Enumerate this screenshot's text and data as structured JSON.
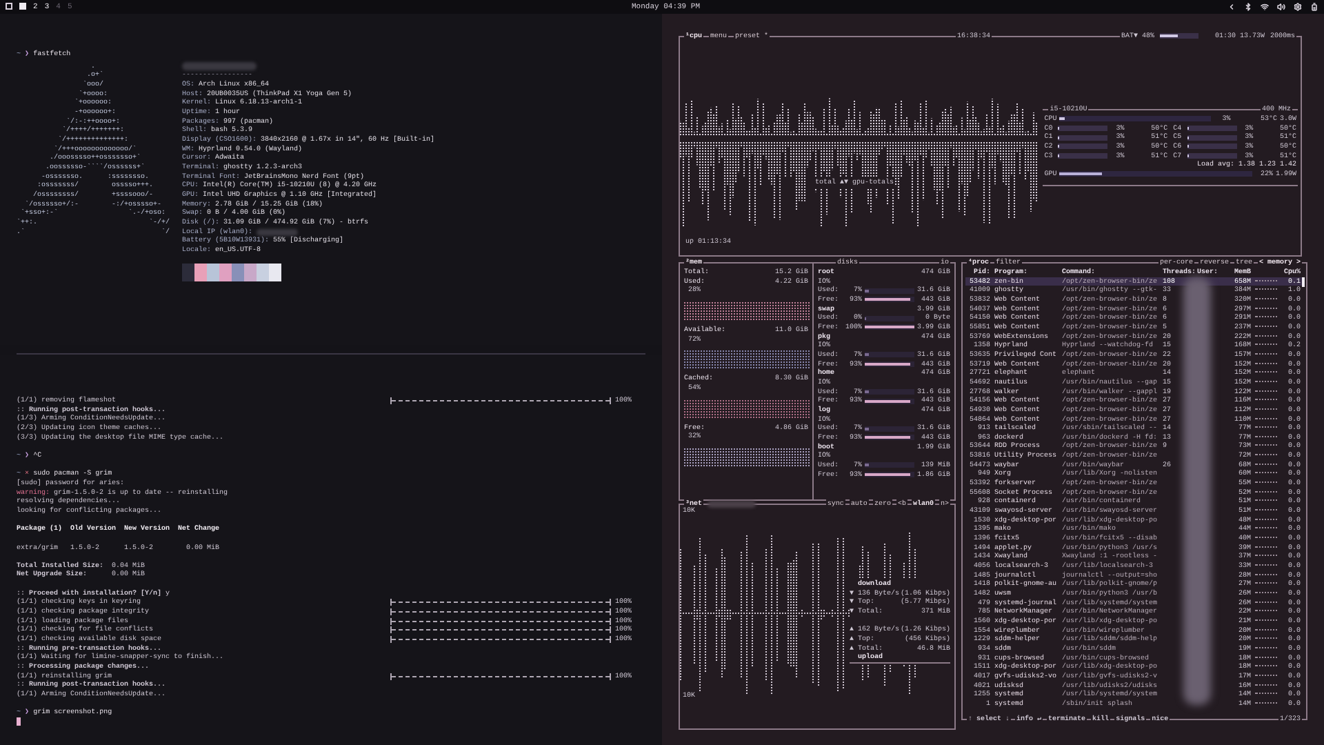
{
  "top_bar": {
    "workspaces": [
      {
        "selected": true,
        "occupied": true
      },
      {
        "label": "2",
        "selected": false,
        "occupied": true
      },
      {
        "label": "3",
        "selected": false,
        "occupied": true
      },
      {
        "label": "4",
        "selected": false,
        "occupied": false
      },
      {
        "label": "5",
        "selected": false,
        "occupied": false
      }
    ],
    "clock": "Monday 04:39 PM"
  },
  "fastfetch": {
    "prompt": {
      "dir": "~",
      "symbol": "❯",
      "command": "fastfetch",
      "error": false
    },
    "logo": [
      "                  .",
      "                 .o+`",
      "                `ooo/",
      "               `+oooo:",
      "              `+oooooo:",
      "              -+oooooo+:",
      "            `/:-:++oooo+:",
      "           `/++++/+++++++:",
      "          `/++++++++++++++:",
      "         `/+++ooooooooooooo/`",
      "        ./ooosssso++osssssso+`",
      "       .oossssso-````/ossssss+`",
      "      -osssssso.      :ssssssso.",
      "     :osssssss/        osssso+++.",
      "    /ossssssss/        +ssssooo/-",
      "  `/ossssso+/:-        -:/+osssso+-",
      " `+sso+:-`                 `.-/+oso:",
      "`++:.                           `-/+/",
      ".`                                 `/"
    ],
    "separator": "-----------------",
    "info": [
      {
        "key": "OS:",
        "value": "Arch Linux x86_64"
      },
      {
        "key": "Host:",
        "value": "20UB0035US (ThinkPad X1 Yoga Gen 5)"
      },
      {
        "key": "Kernel:",
        "value": "Linux 6.18.13-arch1-1"
      },
      {
        "key": "Uptime:",
        "value": "1 hour"
      },
      {
        "key": "Packages:",
        "value": "997 (pacman)"
      },
      {
        "key": "Shell:",
        "value": "bash 5.3.9"
      },
      {
        "key": "Display (CSO1600):",
        "value": "3840x2160 @ 1.67x in 14\", 60 Hz [Built-in]"
      },
      {
        "key": "WM:",
        "value": "Hyprland 0.54.0 (Wayland)"
      },
      {
        "key": "Cursor:",
        "value": "Adwaita"
      },
      {
        "key": "Terminal:",
        "value": "ghostty 1.2.3-arch3"
      },
      {
        "key": "Terminal Font:",
        "value": "JetBrainsMono Nerd Font (9pt)"
      },
      {
        "key": "CPU:",
        "value": "Intel(R) Core(TM) i5-10210U (8) @ 4.20 GHz"
      },
      {
        "key": "GPU:",
        "value": "Intel UHD Graphics @ 1.10 GHz [Integrated]"
      },
      {
        "key": "Memory:",
        "value": "2.78 GiB / 15.25 GiB (18%)"
      },
      {
        "key": "Swap:",
        "value": "0 B / 4.00 GiB (0%)"
      },
      {
        "key": "Disk (/):",
        "value": "31.09 GiB / 474.92 GiB (7%) - btrfs"
      },
      {
        "key": "Local IP (wlan0):"
      },
      {
        "key": "Battery (5B10W13931):",
        "value": "55% [Discharging]"
      },
      {
        "key": "Locale:",
        "value": "en_US.UTF-8"
      }
    ],
    "palette": [
      {
        "color": "#2c2c3a"
      },
      {
        "color": "#e8a0b8"
      },
      {
        "color": "#b8c4d8"
      },
      {
        "color": "#e0a0c0"
      },
      {
        "color": "#8890b8"
      },
      {
        "color": "#c8a8c8"
      },
      {
        "color": "#c8d0e0"
      },
      {
        "color": "#e8e8f0"
      }
    ]
  },
  "terminal": {
    "lines": [
      {
        "kind": "text",
        "text": "(1/1) removing flameshot",
        "progress": {
          "level": 1,
          "reading": "100%"
        }
      },
      {
        "kind": "text",
        "text": ":: **Running post-transaction hooks...**"
      },
      {
        "kind": "text",
        "text": "(1/3) Arming ConditionNeedsUpdate..."
      },
      {
        "kind": "text",
        "text": "(2/3) Updating icon theme caches..."
      },
      {
        "kind": "text",
        "text": "(3/3) Updating the desktop file MIME type cache..."
      },
      {
        "kind": "blank"
      },
      {
        "kind": "prompt",
        "dir": "~",
        "symbol": "❯",
        "command": "^C",
        "error": false
      },
      {
        "kind": "blank"
      },
      {
        "kind": "prompt",
        "dir": "~",
        "symbol": "×",
        "command": "sudo pacman -S grim",
        "error": true
      },
      {
        "kind": "text",
        "text": "[sudo] password for aries:"
      },
      {
        "kind": "warning",
        "label": "warning:",
        "text": "grim-1.5.0-2 is up to date -- reinstalling"
      },
      {
        "kind": "text",
        "text": "resolving dependencies..."
      },
      {
        "kind": "text",
        "text": "looking for conflicting packages..."
      },
      {
        "kind": "blank"
      },
      {
        "kind": "text",
        "text": "Package (1)  Old Version  New Version  Net Change",
        "bold": true
      },
      {
        "kind": "blank"
      },
      {
        "kind": "text",
        "text": "extra/grim   1.5.0-2      1.5.0-2        0.00 MiB"
      },
      {
        "kind": "blank"
      },
      {
        "kind": "text",
        "text": "**Total Installed Size:**  0.04 MiB"
      },
      {
        "kind": "text",
        "text": "**Net Upgrade Size:**      0.00 MiB"
      },
      {
        "kind": "blank"
      },
      {
        "kind": "text",
        "text": ":: **Proceed with installation? [Y/n]** y"
      },
      {
        "kind": "text",
        "text": "(1/1) checking keys in keyring",
        "progress": {
          "level": 1,
          "reading": "100%"
        }
      },
      {
        "kind": "text",
        "text": "(1/1) checking package integrity",
        "progress": {
          "level": 1,
          "reading": "100%"
        }
      },
      {
        "kind": "text",
        "text": "(1/1) loading package files",
        "progress": {
          "level": 1,
          "reading": "100%"
        }
      },
      {
        "kind": "text",
        "text": "(1/1) checking for file conflicts",
        "progress": {
          "level": 1,
          "reading": "100%"
        }
      },
      {
        "kind": "text",
        "text": "(1/1) checking available disk space",
        "progress": {
          "level": 1,
          "reading": "100%"
        }
      },
      {
        "kind": "text",
        "text": ":: **Running pre-transaction hooks...**"
      },
      {
        "kind": "text",
        "text": "(1/1) Waiting for limine-snapper-sync to finish..."
      },
      {
        "kind": "text",
        "text": ":: **Processing package changes...**"
      },
      {
        "kind": "text",
        "text": "(1/1) reinstalling grim",
        "progress": {
          "level": 1,
          "reading": "100%"
        }
      },
      {
        "kind": "text",
        "text": ":: **Running post-transaction hooks...**"
      },
      {
        "kind": "text",
        "text": "(1/1) Arming ConditionNeedsUpdate..."
      },
      {
        "kind": "blank"
      },
      {
        "kind": "prompt",
        "dir": "~",
        "symbol": "❯",
        "command": "grim screenshot.png",
        "error": false
      },
      {
        "kind": "cursor"
      }
    ]
  },
  "btop": {
    "cpu": {
      "titles": [
        "¹cpu",
        "menu",
        "preset *"
      ],
      "clock": "16:38:34",
      "battery": {
        "label": "BAT▼ 48%",
        "level": 0.48
      },
      "power": "01:30 13.73W",
      "interval": "2000ms",
      "graph_label": "total ▲▼ gpu-totals",
      "uptime": "up 01:13:34",
      "model": "i5-10210U",
      "freq": "400 MHz",
      "total": {
        "name": "CPU",
        "level": 0.03,
        "percent": "3%",
        "temp": "53°C",
        "watts": "3.0W"
      },
      "cores": [
        {
          "name": "C0",
          "level": 0.03,
          "percent": "3%",
          "temp": "50°C"
        },
        {
          "name": "C4",
          "level": 0.03,
          "percent": "3%",
          "temp": "50°C"
        },
        {
          "name": "C1",
          "level": 0.03,
          "percent": "3%",
          "temp": "51°C"
        },
        {
          "name": "C5",
          "level": 0.03,
          "percent": "3%",
          "temp": "51°C"
        },
        {
          "name": "C2",
          "level": 0.03,
          "percent": "3%",
          "temp": "50°C"
        },
        {
          "name": "C6",
          "level": 0.03,
          "percent": "3%",
          "temp": "50°C"
        },
        {
          "name": "C3",
          "level": 0.03,
          "percent": "3%",
          "temp": "51°C"
        },
        {
          "name": "C7",
          "level": 0.03,
          "percent": "3%",
          "temp": "51°C"
        }
      ],
      "load": "Load avg: 1.38 1.23 1.42",
      "gpu": {
        "name": "GPU",
        "level": 0.22,
        "percent": "22%",
        "watts": "1.99W"
      }
    },
    "mem": {
      "title": "²mem",
      "rows": [
        {
          "label": "Total:",
          "value": "15.2 GiB"
        },
        {
          "label": "Used:",
          "value": "4.22 GiB",
          "percent": "28%"
        },
        {
          "label": "Available:",
          "value": "11.0 GiB",
          "percent": "72%"
        },
        {
          "label": "Cached:",
          "value": "8.30 GiB",
          "percent": "54%"
        },
        {
          "label": "Free:",
          "value": "4.86 GiB",
          "percent": "32%"
        }
      ]
    },
    "disks": {
      "title": "disks",
      "io_title": "io",
      "items": [
        {
          "name": "root",
          "size": "474 GiB",
          "io": "IO%",
          "used": {
            "label": "Used:",
            "percent": "7%",
            "value": "31.6 GiB",
            "level": 0.07
          },
          "free": {
            "label": "Free:",
            "percent": "93%",
            "value": "443 GiB",
            "level": 0.93
          }
        },
        {
          "name": "swap",
          "size": "3.99 GiB",
          "used": {
            "label": "Used:",
            "percent": "0%",
            "value": "0 Byte",
            "level": 0
          },
          "free": {
            "label": "Free:",
            "percent": "100%",
            "value": "3.99 GiB",
            "level": 1
          }
        },
        {
          "name": "pkg",
          "size": "474 GiB",
          "io": "IO%",
          "used": {
            "label": "Used:",
            "percent": "7%",
            "value": "31.6 GiB",
            "level": 0.07
          },
          "free": {
            "label": "Free:",
            "percent": "93%",
            "value": "443 GiB",
            "level": 0.93
          }
        },
        {
          "name": "home",
          "size": "474 GiB",
          "io": "IO%",
          "used": {
            "label": "Used:",
            "percent": "7%",
            "value": "31.6 GiB",
            "level": 0.07
          },
          "free": {
            "label": "Free:",
            "percent": "93%",
            "value": "443 GiB",
            "level": 0.93
          }
        },
        {
          "name": "log",
          "size": "474 GiB",
          "io": "IO%",
          "used": {
            "label": "Used:",
            "percent": "7%",
            "value": "31.6 GiB",
            "level": 0.07
          },
          "free": {
            "label": "Free:",
            "percent": "93%",
            "value": "443 GiB",
            "level": 0.93
          }
        },
        {
          "name": "boot",
          "size": "1.99 GiB",
          "io": "IO%",
          "used": {
            "label": "Used:",
            "percent": "7%",
            "value": "139 MiB",
            "level": 0.07
          },
          "free": {
            "label": "Free:",
            "percent": "93%",
            "value": "1.86 GiB",
            "level": 0.93
          }
        }
      ]
    },
    "net": {
      "title": "³net",
      "options": [
        "sync",
        "auto",
        "zero"
      ],
      "iface": [
        "<b",
        "wlan0",
        "n>"
      ],
      "scale_top": "10K",
      "scale_bottom": "10K",
      "download": {
        "title": "download",
        "rows": [
          {
            "arrow": "▼",
            "label": "136 Byte/s",
            "value": "(1.06 Kibps)"
          },
          {
            "arrow": "▼",
            "label": "Top:",
            "value": "(5.77 Mibps)"
          },
          {
            "arrow": "▼",
            "label": "Total:",
            "value": "371 MiB"
          }
        ]
      },
      "upload": {
        "title": "upload",
        "rows": [
          {
            "arrow": "▲",
            "label": "162 Byte/s",
            "value": "(1.26 Kibps)"
          },
          {
            "arrow": "▲",
            "label": "Top:",
            "value": "(456 Kibps)"
          },
          {
            "arrow": "▲",
            "label": "Total:",
            "value": "46.8 MiB"
          }
        ]
      }
    },
    "proc": {
      "titles": [
        "⁴proc",
        "filter"
      ],
      "options": [
        "per-core",
        "reverse",
        "tree",
        "< memory >"
      ],
      "columns": [
        "Pid:",
        "Program:",
        "Command:",
        "Threads:",
        "User:",
        "MemB",
        "Cpu%"
      ],
      "rows": [
        {
          "pid": "53482",
          "program": "zen-bin",
          "command": "/opt/zen-browser-bin/ze",
          "threads": "108",
          "mem": "658M",
          "cpu": "0.1",
          "selected": true
        },
        {
          "pid": "41009",
          "program": "ghostty",
          "command": "/usr/bin/ghostty --gtk-",
          "threads": "33",
          "mem": "384M",
          "cpu": "1.0",
          "selected": false
        },
        {
          "pid": "53832",
          "program": "Web Content",
          "command": "/opt/zen-browser-bin/ze",
          "threads": "8",
          "mem": "320M",
          "cpu": "0.0",
          "selected": false
        },
        {
          "pid": "54037",
          "program": "Web Content",
          "command": "/opt/zen-browser-bin/ze",
          "threads": "6",
          "mem": "297M",
          "cpu": "0.0",
          "selected": false
        },
        {
          "pid": "54150",
          "program": "Web Content",
          "command": "/opt/zen-browser-bin/ze",
          "threads": "6",
          "mem": "291M",
          "cpu": "0.0",
          "selected": false
        },
        {
          "pid": "55851",
          "program": "Web Content",
          "command": "/opt/zen-browser-bin/ze",
          "threads": "5",
          "mem": "237M",
          "cpu": "0.0",
          "selected": false
        },
        {
          "pid": "53769",
          "program": "WebExtensions",
          "command": "/opt/zen-browser-bin/ze",
          "threads": "20",
          "mem": "222M",
          "cpu": "0.0",
          "selected": false
        },
        {
          "pid": "1358",
          "program": "Hyprland",
          "command": "Hyprland --watchdog-fd",
          "threads": "15",
          "mem": "168M",
          "cpu": "0.2",
          "selected": false
        },
        {
          "pid": "53635",
          "program": "Privileged Cont",
          "command": "/opt/zen-browser-bin/ze",
          "threads": "22",
          "mem": "157M",
          "cpu": "0.0",
          "selected": false
        },
        {
          "pid": "53719",
          "program": "Web Content",
          "command": "/opt/zen-browser-bin/ze",
          "threads": "20",
          "mem": "152M",
          "cpu": "0.0",
          "selected": false
        },
        {
          "pid": "27721",
          "program": "elephant",
          "command": "elephant",
          "threads": "14",
          "mem": "152M",
          "cpu": "0.0",
          "selected": false
        },
        {
          "pid": "54692",
          "program": "nautilus",
          "command": "/usr/bin/nautilus --gap",
          "threads": "15",
          "mem": "152M",
          "cpu": "0.0",
          "selected": false
        },
        {
          "pid": "27768",
          "program": "walker",
          "command": "/usr/bin/walker --gappl",
          "threads": "19",
          "mem": "122M",
          "cpu": "0.0",
          "selected": false
        },
        {
          "pid": "54156",
          "program": "Web Content",
          "command": "/opt/zen-browser-bin/ze",
          "threads": "27",
          "mem": "116M",
          "cpu": "0.0",
          "selected": false
        },
        {
          "pid": "54930",
          "program": "Web Content",
          "command": "/opt/zen-browser-bin/ze",
          "threads": "27",
          "mem": "112M",
          "cpu": "0.0",
          "selected": false
        },
        {
          "pid": "54864",
          "program": "Web Content",
          "command": "/opt/zen-browser-bin/ze",
          "threads": "27",
          "mem": "110M",
          "cpu": "0.0",
          "selected": false
        },
        {
          "pid": "913",
          "program": "tailscaled",
          "command": "/usr/sbin/tailscaled --",
          "threads": "14",
          "mem": "77M",
          "cpu": "0.0",
          "selected": false
        },
        {
          "pid": "963",
          "program": "dockerd",
          "command": "/usr/bin/dockerd -H fd:",
          "threads": "13",
          "mem": "77M",
          "cpu": "0.0",
          "selected": false
        },
        {
          "pid": "53644",
          "program": "RDD Process",
          "command": "/opt/zen-browser-bin/ze",
          "threads": "9",
          "mem": "73M",
          "cpu": "0.0",
          "selected": false
        },
        {
          "pid": "53816",
          "program": "Utility Process",
          "command": "/opt/zen-browser-bin/ze",
          "mem": "72M",
          "cpu": "0.0",
          "selected": false
        },
        {
          "pid": "54473",
          "program": "waybar",
          "command": "/usr/bin/waybar",
          "threads": "26",
          "mem": "68M",
          "cpu": "0.0",
          "selected": false
        },
        {
          "pid": "949",
          "program": "Xorg",
          "command": "/usr/lib/Xorg -nolisten",
          "mem": "60M",
          "cpu": "0.0",
          "selected": false
        },
        {
          "pid": "53392",
          "program": "forkserver",
          "command": "/opt/zen-browser-bin/ze",
          "mem": "55M",
          "cpu": "0.0",
          "selected": false
        },
        {
          "pid": "55608",
          "program": "Socket Process",
          "command": "/opt/zen-browser-bin/ze",
          "mem": "52M",
          "cpu": "0.0",
          "selected": false
        },
        {
          "pid": "928",
          "program": "containerd",
          "command": "/usr/bin/containerd",
          "mem": "51M",
          "cpu": "0.0",
          "selected": false
        },
        {
          "pid": "43109",
          "program": "swayosd-server",
          "command": "/usr/bin/swayosd-server",
          "mem": "51M",
          "cpu": "0.0",
          "selected": false
        },
        {
          "pid": "1530",
          "program": "xdg-desktop-por",
          "command": "/usr/lib/xdg-desktop-po",
          "mem": "48M",
          "cpu": "0.0",
          "selected": false
        },
        {
          "pid": "1395",
          "program": "mako",
          "command": "/usr/bin/mako",
          "mem": "44M",
          "cpu": "0.0",
          "selected": false
        },
        {
          "pid": "1396",
          "program": "fcitx5",
          "command": "/usr/bin/fcitx5 --disab",
          "mem": "40M",
          "cpu": "0.0",
          "selected": false
        },
        {
          "pid": "1494",
          "program": "applet.py",
          "command": "/usr/bin/python3 /usr/s",
          "mem": "39M",
          "cpu": "0.0",
          "selected": false
        },
        {
          "pid": "1434",
          "program": "Xwayland",
          "command": "Xwayland :1 -rootless -",
          "mem": "37M",
          "cpu": "0.0",
          "selected": false
        },
        {
          "pid": "4056",
          "program": "localsearch-3",
          "command": "/usr/lib/localsearch-3",
          "mem": "33M",
          "cpu": "0.0",
          "selected": false
        },
        {
          "pid": "1485",
          "program": "journalctl",
          "command": "journalctl --output=sho",
          "mem": "28M",
          "cpu": "0.0",
          "selected": false
        },
        {
          "pid": "1418",
          "program": "polkit-gnome-au",
          "command": "/usr/lib/polkit-gnome/p",
          "mem": "27M",
          "cpu": "0.0",
          "selected": false
        },
        {
          "pid": "1482",
          "program": "uwsm",
          "command": "/usr/bin/python3 /usr/b",
          "mem": "26M",
          "cpu": "0.0",
          "selected": false
        },
        {
          "pid": "479",
          "program": "systemd-journal",
          "command": "/usr/lib/systemd/system",
          "mem": "26M",
          "cpu": "0.0",
          "selected": false
        },
        {
          "pid": "785",
          "program": "NetworkManager",
          "command": "/usr/bin/NetworkManager",
          "mem": "22M",
          "cpu": "0.0",
          "selected": false
        },
        {
          "pid": "1560",
          "program": "xdg-desktop-por",
          "command": "/usr/lib/xdg-desktop-po",
          "mem": "21M",
          "cpu": "0.0",
          "selected": false
        },
        {
          "pid": "1554",
          "program": "wireplumber",
          "command": "/usr/bin/wireplumber",
          "mem": "20M",
          "cpu": "0.0",
          "selected": false
        },
        {
          "pid": "1229",
          "program": "sddm-helper",
          "command": "/usr/lib/sddm/sddm-help",
          "mem": "20M",
          "cpu": "0.0",
          "selected": false
        },
        {
          "pid": "934",
          "program": "sddm",
          "command": "/usr/bin/sddm",
          "mem": "19M",
          "cpu": "0.0",
          "selected": false
        },
        {
          "pid": "931",
          "program": "cups-browsed",
          "command": "/usr/bin/cups-browsed",
          "mem": "18M",
          "cpu": "0.0",
          "selected": false
        },
        {
          "pid": "1511",
          "program": "xdg-desktop-por",
          "command": "/usr/lib/xdg-desktop-po",
          "mem": "18M",
          "cpu": "0.0",
          "selected": false
        },
        {
          "pid": "4017",
          "program": "gvfs-udisks2-vo",
          "command": "/usr/lib/gvfs-udisks2-v",
          "mem": "17M",
          "cpu": "0.0",
          "selected": false
        },
        {
          "pid": "4021",
          "program": "udisksd",
          "command": "/usr/lib/udisks2/udisks",
          "mem": "16M",
          "cpu": "0.0",
          "selected": false
        },
        {
          "pid": "1255",
          "program": "systemd",
          "command": "/usr/lib/systemd/system",
          "mem": "14M",
          "cpu": "0.0",
          "selected": false
        },
        {
          "pid": "1",
          "program": "systemd",
          "command": "/sbin/init splash",
          "mem": "14M",
          "cpu": "0.0",
          "selected": false
        }
      ],
      "footer": [
        "↑ select ↓",
        "info ↵",
        "terminate",
        "kill",
        "signals",
        "nice"
      ],
      "count": "1/323"
    }
  }
}
